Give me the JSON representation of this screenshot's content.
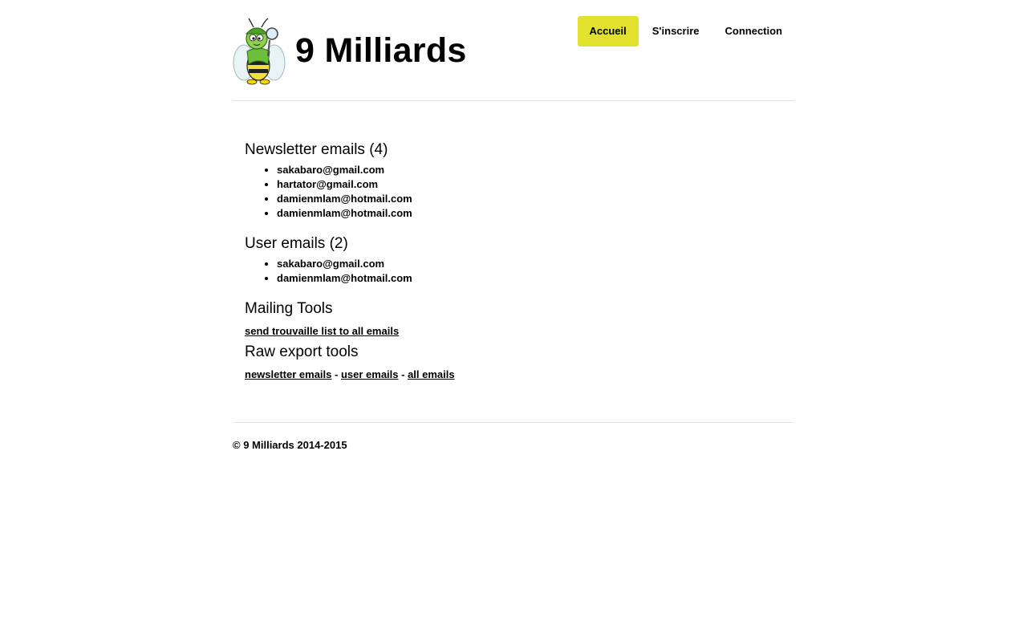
{
  "site": {
    "title": "9 Milliards",
    "logo_icon": "bee-detective-mascot"
  },
  "nav": {
    "items": [
      {
        "label": "Accueil",
        "active": true
      },
      {
        "label": "S'inscrire",
        "active": false
      },
      {
        "label": "Connection",
        "active": false
      }
    ],
    "active_color": "#e2e22e"
  },
  "newsletter": {
    "heading": "Newsletter emails (4)",
    "emails": [
      "sakabaro@gmail.com",
      "hartator@gmail.com",
      "damienmlam@hotmail.com",
      "damienmlam@hotmail.com"
    ]
  },
  "users": {
    "heading": "User emails (2)",
    "emails": [
      "sakabaro@gmail.com",
      "damienmlam@hotmail.com"
    ]
  },
  "mailing_tools": {
    "heading": "Mailing Tools",
    "send_link": "send trouvaille list to all emails"
  },
  "raw_export": {
    "heading": "Raw export tools",
    "newsletter_link": "newsletter emails",
    "user_link": "user emails",
    "all_link": "all emails",
    "separator": " - "
  },
  "footer": {
    "copyright": "© 9 Milliards 2014-2015"
  }
}
